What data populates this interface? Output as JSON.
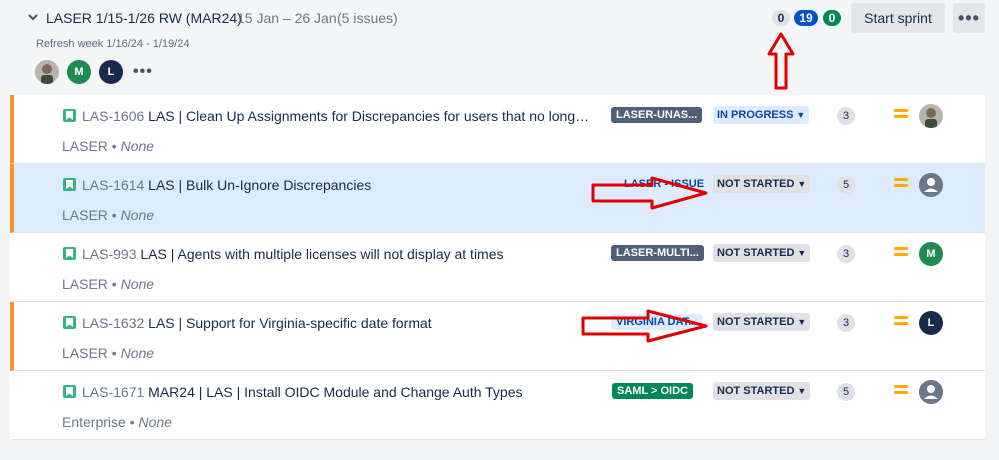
{
  "sprint": {
    "title": "LASER 1/15-1/26 RW (MAR24)",
    "dates": "15 Jan – 26 Jan",
    "issue_count": "(5 issues)",
    "goal": "Refresh week 1/16/24 - 1/19/24",
    "counts": {
      "todo": "0",
      "in_progress": "19",
      "done": "0"
    },
    "start_button": "Start sprint",
    "more_button": "•••",
    "avatars_more": "•••",
    "avatars": [
      {
        "initial": "",
        "kind": "photo"
      },
      {
        "initial": "M",
        "kind": "initial",
        "color": "#1f8a52"
      },
      {
        "initial": "L",
        "kind": "initial",
        "color": "#172b4d"
      }
    ]
  },
  "issues": [
    {
      "key": "LAS-1606",
      "summary": "LAS | Clean Up Assignments for Discrepancies for users that no longer ...",
      "project": "LASER",
      "component": "None",
      "epic": "LASER-UNAS...",
      "epic_color": "gray",
      "status": "IN PROGRESS",
      "status_kind": "prog",
      "points": "3",
      "assignee": {
        "initial": "",
        "kind": "photo"
      }
    },
    {
      "key": "LAS-1614",
      "summary": "LAS | Bulk Un-Ignore Discrepancies",
      "project": "LASER",
      "component": "None",
      "epic": "LASER - ISSUE",
      "epic_color": "blue",
      "status": "NOT STARTED",
      "status_kind": "ns",
      "points": "5",
      "assignee": {
        "initial": "",
        "kind": "unassigned"
      }
    },
    {
      "key": "LAS-993",
      "summary": "LAS | Agents with multiple licenses will not display at times",
      "project": "LASER",
      "component": "None",
      "epic": "LASER-MULTI...",
      "epic_color": "gray",
      "status": "NOT STARTED",
      "status_kind": "ns",
      "points": "3",
      "assignee": {
        "initial": "M",
        "kind": "initial",
        "color": "#1f8a52"
      }
    },
    {
      "key": "LAS-1632",
      "summary": "LAS | Support for Virginia-specific date format",
      "project": "LASER",
      "component": "None",
      "epic": "VIRGINIA DAT...",
      "epic_color": "blue",
      "status": "NOT STARTED",
      "status_kind": "ns",
      "points": "3",
      "assignee": {
        "initial": "L",
        "kind": "initial",
        "color": "#172b4d"
      }
    },
    {
      "key": "LAS-1671",
      "summary": "MAR24 | LAS | Install OIDC Module and Change Auth Types",
      "project": "Enterprise",
      "component": "None",
      "epic": "SAML > OIDC",
      "epic_color": "green",
      "status": "NOT STARTED",
      "status_kind": "ns",
      "points": "5",
      "assignee": {
        "initial": "",
        "kind": "unassigned"
      }
    }
  ],
  "colors": {
    "accent": "#0052cc",
    "stripe": "#f79232",
    "priority_medium": "#ffab00",
    "annotation_red": "#e00000"
  }
}
